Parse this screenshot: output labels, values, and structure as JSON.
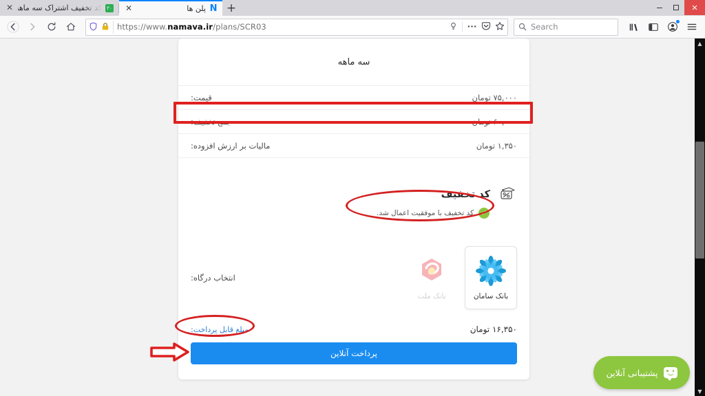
{
  "browser": {
    "tabs": [
      {
        "title": "کد تخفیف اشتراک سه ماهه نماوا",
        "favicon": "green-badge-icon",
        "active": false,
        "close_label": "✕"
      },
      {
        "title": "پلن ها",
        "favicon": "namava-n-icon",
        "active": true,
        "close_label": "✕"
      }
    ],
    "new_tab_label": "+",
    "window_controls": {
      "minimize": "‒",
      "maximize": "❐",
      "close": "✕"
    },
    "nav": {
      "back_icon": "back-arrow-icon",
      "forward_icon": "forward-arrow-icon",
      "reload_icon": "reload-icon",
      "home_icon": "home-icon"
    },
    "url": {
      "shield_icon": "shield-icon",
      "lock_icon": "padlock-icon",
      "scheme": "https://www.",
      "domain": "namava.ir",
      "path": "/plans/SCR03",
      "reader_icon": "reader-view-icon",
      "page_actions_icon": "ellipsis-icon",
      "pocket_icon": "pocket-icon",
      "bookmark_icon": "star-icon"
    },
    "search": {
      "placeholder": "Search",
      "icon": "search-icon"
    },
    "toolbar_right": {
      "library_icon": "library-icon",
      "sidebar_icon": "sidebar-icon",
      "account_icon": "account-icon",
      "menu_icon": "hamburger-menu-icon"
    },
    "scrollbar": {
      "up_arrow": "▲",
      "down_arrow": "▼"
    }
  },
  "page": {
    "card_title": "سه ماهه",
    "rows": [
      {
        "label": "قیمت:",
        "value": "۷۵,۰۰۰ تومان"
      },
      {
        "label": "جمع تخفیف:",
        "value": "۶۰,۰۰۰ تومان"
      },
      {
        "label": "مالیات بر ارزش افزوده:",
        "value": "۱,۳۵۰ تومان"
      }
    ],
    "discount": {
      "title": "کد تخفیف",
      "icon": "percent-card-icon",
      "success_message": "کد تخفیف با موفقیت اعمال شد.",
      "check_icon": "check-circle-icon",
      "success_color": "#8dc63f"
    },
    "gateway": {
      "label": "انتخاب درگاه:",
      "banks": [
        {
          "name": "بانک ملت",
          "logo": "mellat-bank-logo",
          "selected": false,
          "disabled": true
        },
        {
          "name": "بانک سامان",
          "logo": "saman-bank-logo",
          "selected": true,
          "disabled": false
        }
      ]
    },
    "payable": {
      "label": "مبلغ قابل پرداخت:",
      "value": "۱۶,۳۵۰ تومان"
    },
    "pay_button": "پرداخت آنلاین",
    "support_widget": {
      "label": "پشتیبانی آنلاین",
      "icon": "chat-smiley-icon",
      "color": "#8dc63f"
    },
    "annotations": {
      "color": "#dd2020",
      "highlight_discount_row": "rectangle around جمع تخفیف row",
      "circle_discount_message": "ellipse around success message",
      "circle_payable_amount": "ellipse around payable amount",
      "arrow_pay_button": "arrow pointing to pay button"
    }
  }
}
